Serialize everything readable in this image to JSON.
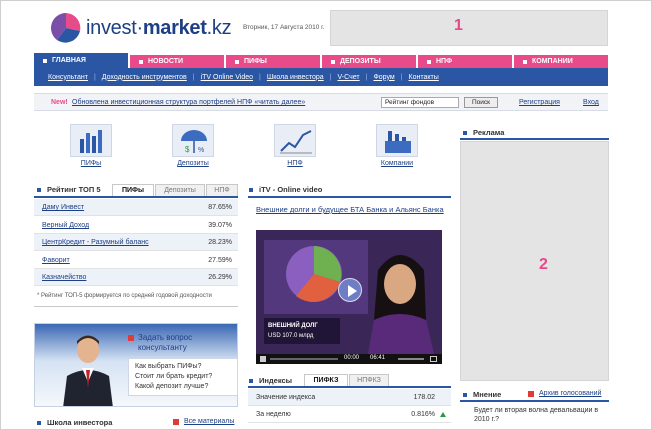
{
  "header": {
    "logo_prefix": "invest·",
    "logo_brand": "market",
    "logo_suffix": ".kz",
    "date": "Вторник, 17 Августа 2010 г.",
    "banner_top": "1",
    "banner_right": "2"
  },
  "tabs": [
    {
      "label": "ГЛАВНАЯ",
      "active": true
    },
    {
      "label": "НОВОСТИ",
      "active": false
    },
    {
      "label": "ПИФЫ",
      "active": false
    },
    {
      "label": "ДЕПОЗИТЫ",
      "active": false
    },
    {
      "label": "НПФ",
      "active": false
    },
    {
      "label": "КОМПАНИИ",
      "active": false
    }
  ],
  "nav": [
    "Консультант",
    "Доходность инструментов",
    "iTV Online Video",
    "Школа инвестора",
    "V-Счет",
    "Форум",
    "Контакты"
  ],
  "strip": {
    "new_label": "New!",
    "news_text": "Обновлена инвестиционная структура портфелей НПФ «читать далее»",
    "search_value": "Рейтинг фондов",
    "search_button": "Поиск",
    "register": "Регистрация",
    "login": "Вход"
  },
  "categories": [
    "ПИФы",
    "Депозиты",
    "НПФ",
    "Компании"
  ],
  "rating": {
    "title": "Рейтинг ТОП 5",
    "tabs": [
      "ПИФы",
      "Депозиты",
      "НПФ"
    ],
    "rows": [
      {
        "name": "Даму Инвест",
        "value": "87.65%"
      },
      {
        "name": "Верный Доход",
        "value": "39.07%"
      },
      {
        "name": "ЦентрКредит - Разумный баланс",
        "value": "28.23%"
      },
      {
        "name": "Фаворит",
        "value": "27.59%"
      },
      {
        "name": "Казначейство",
        "value": "26.29%"
      }
    ],
    "note": "* Рейтинг ТОП-5 формируется по средней годовой доходности"
  },
  "consultant": {
    "ask": "Задать вопрос консультанту",
    "questions": [
      "Как выбрать ПИФы?",
      "Стоит ли брать кредит?",
      "Какой депозит лучше?"
    ]
  },
  "school": {
    "title": "Школа инвестора",
    "all": "Все материалы"
  },
  "video": {
    "title": "iTV - Online video",
    "link": "Внешние долги и будущее БТА Банка и Альянс Банка",
    "time_current": "00:00",
    "time_total": "06:41",
    "caption_1": "ВНЕШНИЙ ДОЛГ",
    "caption_2": "USD 107.0 млрд"
  },
  "indexes": {
    "title": "Индексы",
    "tabs": [
      "ПИФКЗ",
      "НПФКЗ"
    ],
    "rows": [
      {
        "name": "Значение индекса",
        "value": "178.02"
      },
      {
        "name": "За неделю",
        "value": "0.816%"
      }
    ]
  },
  "ads": {
    "title": "Реклама"
  },
  "poll": {
    "title": "Мнение",
    "archive": "Архив голосований",
    "question": "Будет ли вторая волна девальвации в 2010 г.?"
  },
  "colors": {
    "brand_blue": "#2a56a4",
    "accent_pink": "#e84b8a",
    "up_green": "#2a9a3a"
  }
}
